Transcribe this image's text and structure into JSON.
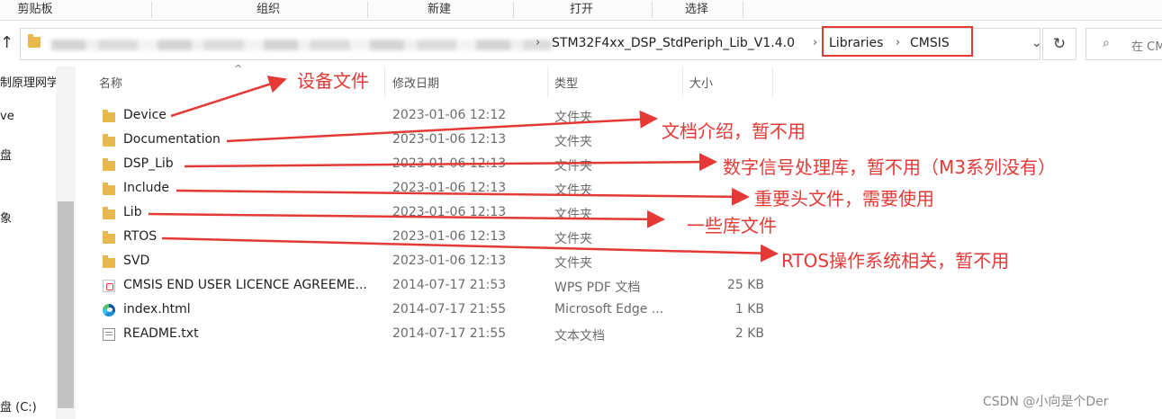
{
  "ribbon": {
    "groups": [
      "剪贴板",
      "组织",
      "新建",
      "打开",
      "选择"
    ]
  },
  "address": {
    "path_tail": "STM32F4xx_DSP_StdPeriph_Lib_V1.4.0",
    "crumb_libraries": "Libraries",
    "crumb_cmsis": "CMSIS",
    "separator": "›",
    "dropdown": "⌄",
    "refresh": "↻",
    "search_placeholder": "在 CM",
    "highlight_color": "#e53935"
  },
  "nav": {
    "up": "↑",
    "items": [
      "制原理网学",
      "ve",
      "盘",
      "",
      "象",
      "盘 (C:)"
    ]
  },
  "columns": {
    "name": "名称",
    "modified": "修改日期",
    "type": "类型",
    "size": "大小"
  },
  "files": [
    {
      "name": "Device",
      "date": "2023-01-06 12:12",
      "type": "文件夹",
      "size": "",
      "icon": "folder-icon"
    },
    {
      "name": "Documentation",
      "date": "2023-01-06 12:13",
      "type": "文件夹",
      "size": "",
      "icon": "folder-icon"
    },
    {
      "name": "DSP_Lib",
      "date": "2023-01-06 12:13",
      "type": "文件夹",
      "size": "",
      "icon": "folder-icon"
    },
    {
      "name": "Include",
      "date": "2023-01-06 12:13",
      "type": "文件夹",
      "size": "",
      "icon": "folder-icon"
    },
    {
      "name": "Lib",
      "date": "2023-01-06 12:13",
      "type": "文件夹",
      "size": "",
      "icon": "folder-icon"
    },
    {
      "name": "RTOS",
      "date": "2023-01-06 12:13",
      "type": "文件夹",
      "size": "",
      "icon": "folder-icon"
    },
    {
      "name": "SVD",
      "date": "2023-01-06 12:13",
      "type": "文件夹",
      "size": "",
      "icon": "folder-icon"
    },
    {
      "name": "CMSIS END USER LICENCE AGREEME...",
      "date": "2014-07-17 21:53",
      "type": "WPS PDF 文档",
      "size": "25 KB",
      "icon": "pdf-icon"
    },
    {
      "name": "index.html",
      "date": "2014-07-17 21:55",
      "type": "Microsoft Edge ...",
      "size": "1 KB",
      "icon": "edge-icon"
    },
    {
      "name": "README.txt",
      "date": "2014-07-17 21:55",
      "type": "文本文档",
      "size": "2 KB",
      "icon": "text-file-icon"
    }
  ],
  "annotations": {
    "device": "设备文件",
    "documentation": "文档介绍，暂不用",
    "dsp_lib": "数字信号处理库，暂不用（M3系列没有）",
    "include": "重要头文件，需要使用",
    "lib": "一些库文件",
    "rtos": "RTOS操作系统相关，暂不用",
    "color": "#e53935"
  },
  "watermark": "CSDN @小向是个Der"
}
